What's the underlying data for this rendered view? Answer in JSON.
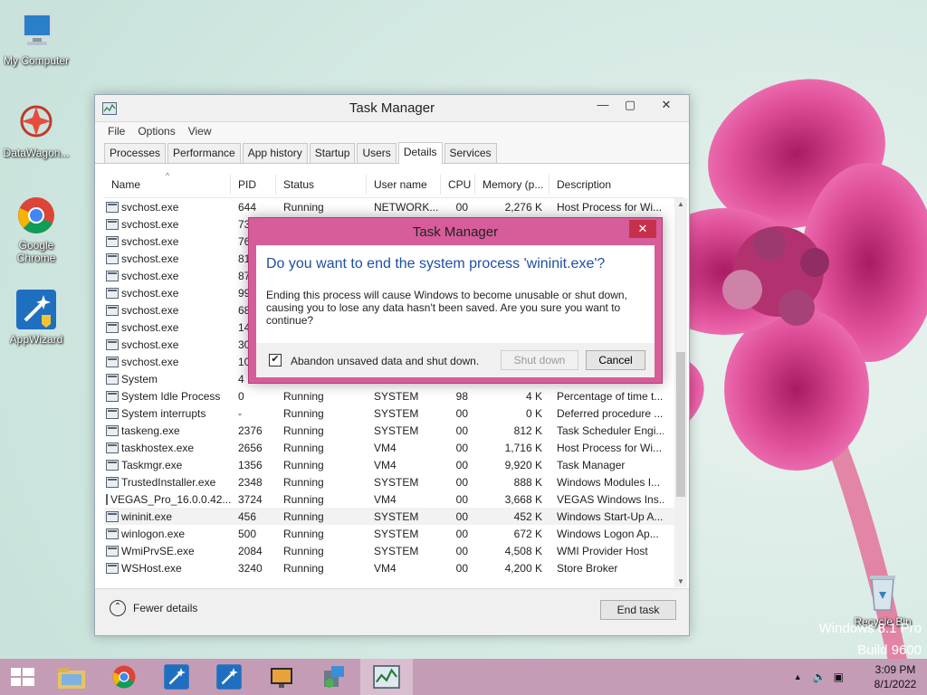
{
  "desktop": {
    "icons": [
      {
        "label": "My Computer"
      },
      {
        "label": "DataWagon..."
      },
      {
        "label": "Google Chrome"
      },
      {
        "label": "AppWizard"
      },
      {
        "label": "Recycle Bin"
      }
    ],
    "watermark_line1": "Windows 8.1 Pro",
    "watermark_line2": "Build 9600"
  },
  "task_manager": {
    "title": "Task Manager",
    "menu": [
      "File",
      "Options",
      "View"
    ],
    "tabs": [
      "Processes",
      "Performance",
      "App history",
      "Startup",
      "Users",
      "Details",
      "Services"
    ],
    "active_tab": "Details",
    "columns": [
      "Name",
      "PID",
      "Status",
      "User name",
      "CPU",
      "Memory (p...",
      "Description"
    ],
    "rows": [
      {
        "name": "svchost.exe",
        "pid": "644",
        "status": "Running",
        "user": "NETWORK...",
        "cpu": "00",
        "mem": "2,276 K",
        "desc": "Host Process for Wi..."
      },
      {
        "name": "svchost.exe",
        "pid": "73",
        "status": "",
        "user": "",
        "cpu": "",
        "mem": "",
        "desc": ""
      },
      {
        "name": "svchost.exe",
        "pid": "76",
        "status": "",
        "user": "",
        "cpu": "",
        "mem": "",
        "desc": ""
      },
      {
        "name": "svchost.exe",
        "pid": "81",
        "status": "",
        "user": "",
        "cpu": "",
        "mem": "",
        "desc": ""
      },
      {
        "name": "svchost.exe",
        "pid": "87",
        "status": "",
        "user": "",
        "cpu": "",
        "mem": "",
        "desc": ""
      },
      {
        "name": "svchost.exe",
        "pid": "99",
        "status": "",
        "user": "",
        "cpu": "",
        "mem": "",
        "desc": ""
      },
      {
        "name": "svchost.exe",
        "pid": "68",
        "status": "",
        "user": "",
        "cpu": "",
        "mem": "",
        "desc": ""
      },
      {
        "name": "svchost.exe",
        "pid": "14",
        "status": "",
        "user": "",
        "cpu": "",
        "mem": "",
        "desc": ""
      },
      {
        "name": "svchost.exe",
        "pid": "30",
        "status": "",
        "user": "",
        "cpu": "",
        "mem": "",
        "desc": ""
      },
      {
        "name": "svchost.exe",
        "pid": "10",
        "status": "",
        "user": "",
        "cpu": "",
        "mem": "",
        "desc": ""
      },
      {
        "name": "System",
        "pid": "4",
        "status": "",
        "user": "",
        "cpu": "",
        "mem": "",
        "desc": ""
      },
      {
        "name": "System Idle Process",
        "pid": "0",
        "status": "Running",
        "user": "SYSTEM",
        "cpu": "98",
        "mem": "4 K",
        "desc": "Percentage of time t..."
      },
      {
        "name": "System interrupts",
        "pid": "-",
        "status": "Running",
        "user": "SYSTEM",
        "cpu": "00",
        "mem": "0 K",
        "desc": "Deferred procedure ..."
      },
      {
        "name": "taskeng.exe",
        "pid": "2376",
        "status": "Running",
        "user": "SYSTEM",
        "cpu": "00",
        "mem": "812 K",
        "desc": "Task Scheduler Engi..."
      },
      {
        "name": "taskhostex.exe",
        "pid": "2656",
        "status": "Running",
        "user": "VM4",
        "cpu": "00",
        "mem": "1,716 K",
        "desc": "Host Process for Wi..."
      },
      {
        "name": "Taskmgr.exe",
        "pid": "1356",
        "status": "Running",
        "user": "VM4",
        "cpu": "00",
        "mem": "9,920 K",
        "desc": "Task Manager"
      },
      {
        "name": "TrustedInstaller.exe",
        "pid": "2348",
        "status": "Running",
        "user": "SYSTEM",
        "cpu": "00",
        "mem": "888 K",
        "desc": "Windows Modules I..."
      },
      {
        "name": "VEGAS_Pro_16.0.0.42...",
        "pid": "3724",
        "status": "Running",
        "user": "VM4",
        "cpu": "00",
        "mem": "3,668 K",
        "desc": "VEGAS Windows Ins..."
      },
      {
        "name": "wininit.exe",
        "pid": "456",
        "status": "Running",
        "user": "SYSTEM",
        "cpu": "00",
        "mem": "452 K",
        "desc": "Windows Start-Up A..."
      },
      {
        "name": "winlogon.exe",
        "pid": "500",
        "status": "Running",
        "user": "SYSTEM",
        "cpu": "00",
        "mem": "672 K",
        "desc": "Windows Logon Ap..."
      },
      {
        "name": "WmiPrvSE.exe",
        "pid": "2084",
        "status": "Running",
        "user": "SYSTEM",
        "cpu": "00",
        "mem": "4,508 K",
        "desc": "WMI Provider Host"
      },
      {
        "name": "WSHost.exe",
        "pid": "3240",
        "status": "Running",
        "user": "VM4",
        "cpu": "00",
        "mem": "4,200 K",
        "desc": "Store Broker"
      }
    ],
    "selected_row": "wininit.exe",
    "fewer_details": "Fewer details",
    "end_task": "End task"
  },
  "dialog": {
    "title": "Task Manager",
    "heading": "Do you want to end the system process 'wininit.exe'?",
    "message": "Ending this process will cause Windows to become unusable or shut down, causing you to lose any data hasn't been saved. Are you sure you want to continue?",
    "checkbox_label": "Abandon unsaved data and shut down.",
    "checkbox_checked": true,
    "shutdown_label": "Shut down",
    "cancel_label": "Cancel",
    "accent_color": "#d65c9a",
    "close_color": "#c7304d"
  },
  "taskbar": {
    "apps": [
      "file-explorer",
      "google-chrome",
      "appwizard",
      "appwizard",
      "media-player",
      "installer",
      "task-manager"
    ],
    "time": "3:09 PM",
    "date": "8/1/2022"
  }
}
